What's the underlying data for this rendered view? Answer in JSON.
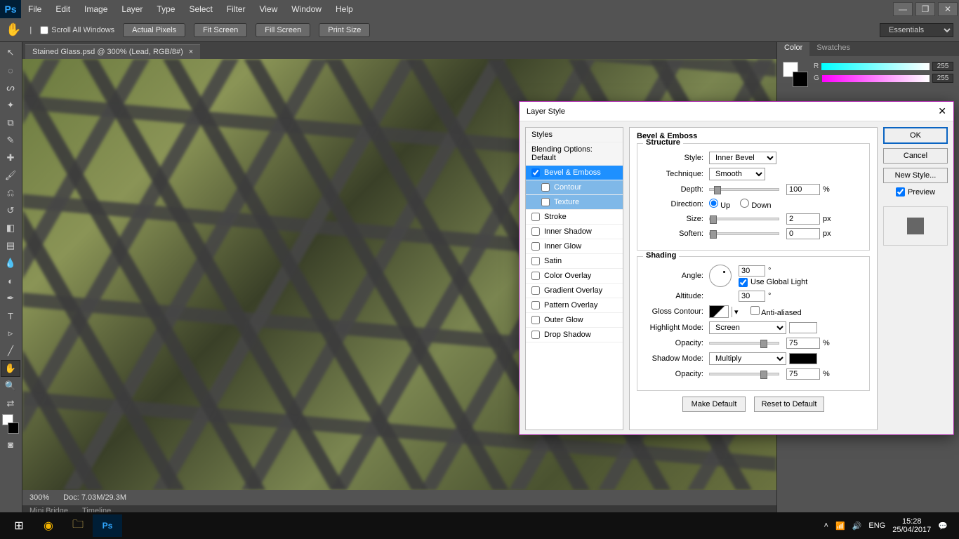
{
  "menubar": {
    "items": [
      "File",
      "Edit",
      "Image",
      "Layer",
      "Type",
      "Select",
      "Filter",
      "View",
      "Window",
      "Help"
    ]
  },
  "options_bar": {
    "scroll_all": "Scroll All Windows",
    "actual_pixels": "Actual Pixels",
    "fit_screen": "Fit Screen",
    "fill_screen": "Fill Screen",
    "print_size": "Print Size",
    "workspace": "Essentials"
  },
  "document": {
    "tab_title": "Stained Glass.psd @ 300% (Lead, RGB/8#)",
    "zoom": "300%",
    "doc_info": "Doc: 7.03M/29.3M"
  },
  "bottom_panel_tabs": [
    "Mini Bridge",
    "Timeline"
  ],
  "color_panel": {
    "tabs": [
      "Color",
      "Swatches"
    ],
    "r_label": "R",
    "r_val": "255",
    "g_label": "G",
    "g_val": "255"
  },
  "dialog": {
    "title": "Layer Style",
    "ok": "OK",
    "cancel": "Cancel",
    "new_style": "New Style...",
    "preview_label": "Preview",
    "styles_header": "Styles",
    "blending_opts": "Blending Options: Default",
    "styles": [
      {
        "label": "Bevel & Emboss",
        "checked": true,
        "selected": true
      },
      {
        "label": "Contour",
        "checked": false,
        "sub": true,
        "subsel": true
      },
      {
        "label": "Texture",
        "checked": false,
        "sub": true,
        "subsel": true
      },
      {
        "label": "Stroke",
        "checked": false
      },
      {
        "label": "Inner Shadow",
        "checked": false
      },
      {
        "label": "Inner Glow",
        "checked": false
      },
      {
        "label": "Satin",
        "checked": false
      },
      {
        "label": "Color Overlay",
        "checked": false
      },
      {
        "label": "Gradient Overlay",
        "checked": false
      },
      {
        "label": "Pattern Overlay",
        "checked": false
      },
      {
        "label": "Outer Glow",
        "checked": false
      },
      {
        "label": "Drop Shadow",
        "checked": false
      }
    ],
    "section_title": "Bevel & Emboss",
    "structure": {
      "legend": "Structure",
      "style_label": "Style:",
      "style_val": "Inner Bevel",
      "technique_label": "Technique:",
      "technique_val": "Smooth",
      "depth_label": "Depth:",
      "depth_val": "100",
      "depth_unit": "%",
      "direction_label": "Direction:",
      "up": "Up",
      "down": "Down",
      "size_label": "Size:",
      "size_val": "2",
      "size_unit": "px",
      "soften_label": "Soften:",
      "soften_val": "0",
      "soften_unit": "px"
    },
    "shading": {
      "legend": "Shading",
      "angle_label": "Angle:",
      "angle_val": "30",
      "angle_unit": "°",
      "global_light": "Use Global Light",
      "altitude_label": "Altitude:",
      "altitude_val": "30",
      "altitude_unit": "°",
      "gloss_label": "Gloss Contour:",
      "antialiased": "Anti-aliased",
      "highlight_label": "Highlight Mode:",
      "highlight_val": "Screen",
      "h_opacity_label": "Opacity:",
      "h_opacity_val": "75",
      "h_opacity_unit": "%",
      "shadow_label": "Shadow Mode:",
      "shadow_val": "Multiply",
      "s_opacity_label": "Opacity:",
      "s_opacity_val": "75",
      "s_opacity_unit": "%",
      "highlight_color": "#ffffff",
      "shadow_color": "#000000"
    },
    "make_default": "Make Default",
    "reset_default": "Reset to Default"
  },
  "taskbar": {
    "lang": "ENG",
    "time": "15:28",
    "date": "25/04/2017"
  }
}
